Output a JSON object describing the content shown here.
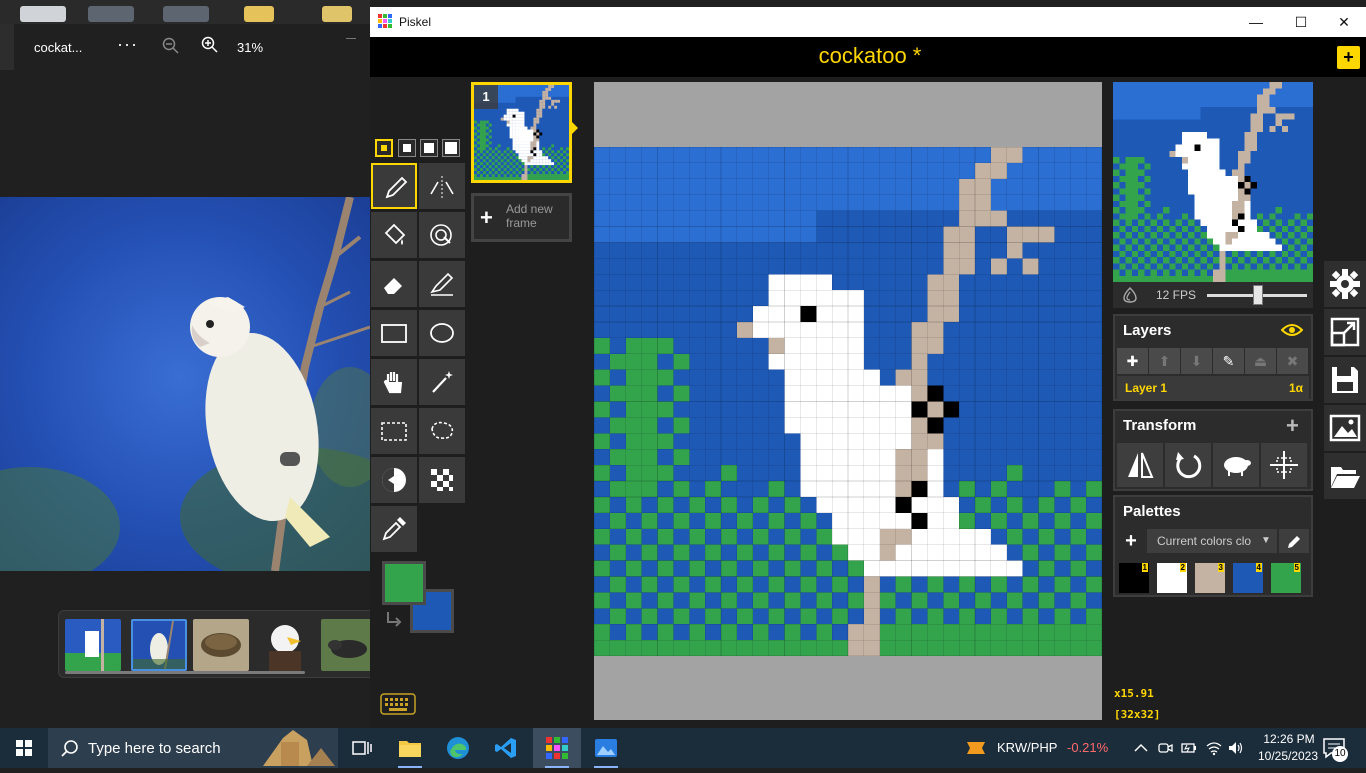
{
  "photos_app": {
    "file_name": "cockat...",
    "more_label": "···",
    "zoom_level": "31%",
    "filmstrip": [
      {
        "name": "thumb-cockatoo-pixel",
        "selected": false
      },
      {
        "name": "thumb-cockatoo-photo",
        "selected": true
      },
      {
        "name": "thumb-turtle",
        "selected": false
      },
      {
        "name": "thumb-eagle",
        "selected": false
      },
      {
        "name": "thumb-badger",
        "selected": false
      }
    ]
  },
  "piskel": {
    "window_title": "Piskel",
    "window_controls": {
      "minimize": "—",
      "maximize": "☐",
      "close": "✕"
    },
    "document_title": "cockatoo *",
    "new_button": "+",
    "pen_sizes": [
      1,
      2,
      3,
      4
    ],
    "selected_pen_size": 1,
    "tools": [
      "pen-tool",
      "mirror-pen-tool",
      "paint-bucket-tool",
      "same-color-bucket-tool",
      "eraser-tool",
      "stroke-tool",
      "rectangle-tool",
      "ellipse-tool",
      "move-tool",
      "magic-wand-tool",
      "rectangle-select-tool",
      "lasso-select-tool",
      "lighten-tool",
      "dithering-tool",
      "color-picker-tool"
    ],
    "selected_tool": "pen-tool",
    "primary_color": "#33a34c",
    "secondary_color": "#1e59b5",
    "frames": {
      "frame_number": "1",
      "add_frame_label": "Add new frame"
    },
    "preview": {
      "fps_label": "12 FPS",
      "fps": 12
    },
    "layers": {
      "title": "Layers",
      "items": [
        {
          "name": "Layer 1",
          "opacity": "1α"
        }
      ]
    },
    "transform": {
      "title": "Transform",
      "add": "+"
    },
    "palettes": {
      "title": "Palettes",
      "selected": "Current colors clo",
      "swatches": [
        {
          "num": "1",
          "color": "#000000"
        },
        {
          "num": "2",
          "color": "#ffffff"
        },
        {
          "num": "3",
          "color": "#c4b2a3"
        },
        {
          "num": "4",
          "color": "#1e59b5"
        },
        {
          "num": "5",
          "color": "#33a34c"
        }
      ]
    },
    "zoom": "x15.91",
    "canvas_size": "[32x32]",
    "colors": {
      "sky_light": "#2b6fd3",
      "sky_dark": "#1e59b5",
      "branch": "#c4b2a3",
      "bird": "#ffffff",
      "eye": "#000000",
      "leaf": "#33a34c",
      "accent": "#ffd700"
    }
  },
  "taskbar": {
    "search_placeholder": "Type here to search",
    "stock_name": "KRW/PHP",
    "stock_change": "-0.21%",
    "time": "12:26 PM",
    "date": "10/25/2023",
    "notification_count": "10"
  }
}
